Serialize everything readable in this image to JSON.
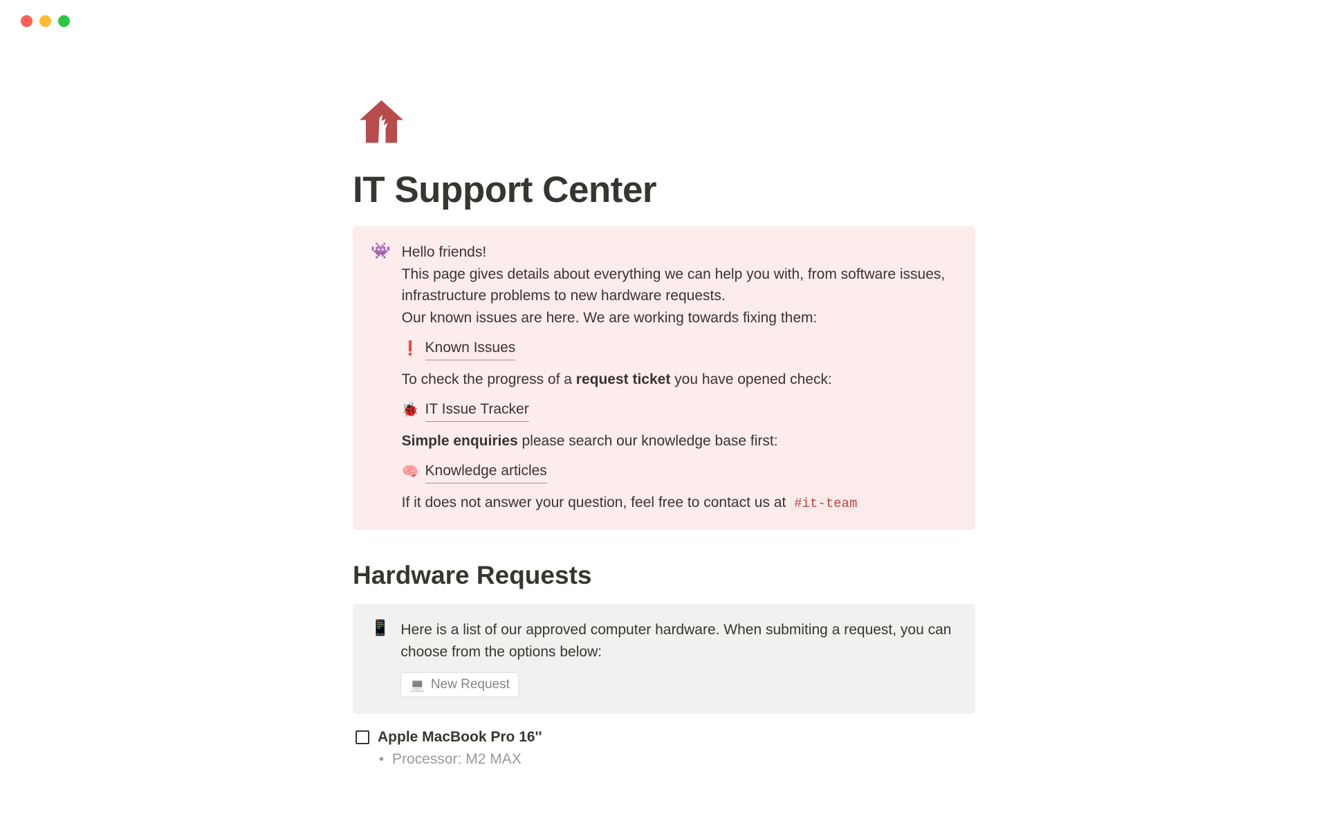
{
  "page": {
    "title": "IT Support Center"
  },
  "intro_callout": {
    "greeting": "Hello friends!",
    "description": "This page gives details about everything we can help you with, from software issues, infrastructure problems to new hardware requests.",
    "known_issues_intro": "Our known issues are here. We are working towards fixing them:",
    "links": {
      "known_issues": "Known Issues",
      "issue_tracker": "IT Issue Tracker",
      "knowledge": "Knowledge articles"
    },
    "ticket_check_prefix": "To check the progress of a ",
    "ticket_check_bold": "request ticket",
    "ticket_check_suffix": " you have opened check:",
    "simple_enquiries_bold": "Simple enquiries",
    "simple_enquiries_suffix": " please search our knowledge base first:",
    "contact_text": "If it does not answer your question, feel free to contact us at ",
    "contact_channel": "#it-team"
  },
  "hardware": {
    "heading": "Hardware Requests",
    "callout_text": "Here is a list of our approved computer hardware.  When submiting a request, you can choose from the options below:",
    "new_request_label": "New Request",
    "items": [
      {
        "name": "Apple MacBook Pro 16''",
        "spec_processor": "Processor: M2 MAX"
      }
    ]
  }
}
